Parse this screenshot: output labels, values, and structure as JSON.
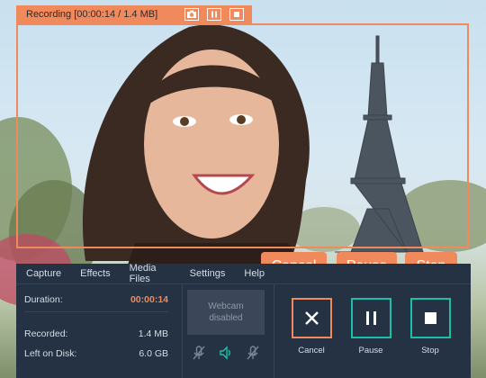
{
  "recording": {
    "status_text": "Recording [00:00:14 / 1.4 MB]",
    "controls": [
      "camera-icon",
      "pause-icon",
      "stop-icon"
    ]
  },
  "menu": {
    "items": [
      "Capture",
      "Effects",
      "Media Files",
      "Settings",
      "Help"
    ]
  },
  "info": {
    "duration_label": "Duration:",
    "duration_value": "00:00:14",
    "recorded_label": "Recorded:",
    "recorded_value": "1.4 MB",
    "disk_label": "Left on Disk:",
    "disk_value": "6.0 GB"
  },
  "webcam": {
    "status_line1": "Webcam",
    "status_line2": "disabled"
  },
  "audio": {
    "icons": [
      "microphone-muted-icon",
      "speaker-icon",
      "microphone-off-icon"
    ]
  },
  "controls": {
    "cancel_label": "Cancel",
    "pause_label": "Pause",
    "stop_label": "Stop"
  },
  "callouts": {
    "cancel": "Cancel",
    "pause": "Pause",
    "stop": "Stop"
  },
  "colors": {
    "accent": "#f08a5d",
    "teal": "#1ebfa8",
    "panel": "#243244"
  }
}
